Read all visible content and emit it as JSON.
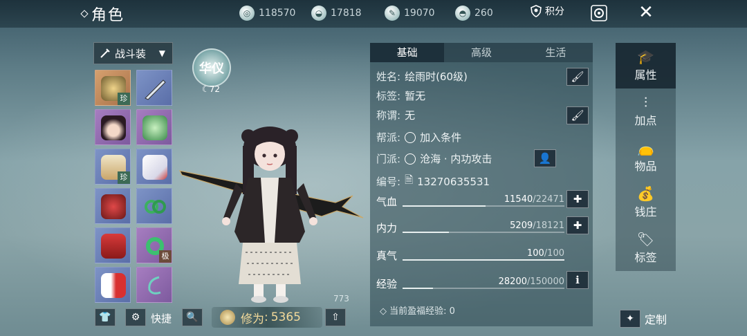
{
  "header": {
    "title": "角色",
    "currencies": [
      {
        "icon": "film-reel-icon",
        "value": "118570"
      },
      {
        "icon": "silver-ingot-icon",
        "value": "17818"
      },
      {
        "icon": "jade-token-icon",
        "value": "19070"
      },
      {
        "icon": "gold-ingot-icon",
        "value": "260"
      }
    ],
    "points_label": "积分"
  },
  "outfit": {
    "selected": "战斗装"
  },
  "equipment": {
    "badges": {
      "rare": "珍",
      "extreme": "极"
    }
  },
  "character": {
    "emblem_text": "华仪",
    "emblem_level": "72",
    "wing_level": "773",
    "cultivation_label": "修为",
    "cultivation_value": "5365"
  },
  "toolbar": {
    "quick_label": "快捷"
  },
  "panel": {
    "tabs": [
      "基础",
      "高级",
      "生活"
    ],
    "name_label": "姓名:",
    "name_value": "绘雨时(60级)",
    "tag_label": "标签:",
    "tag_value": "暂无",
    "title_label": "称谓:",
    "title_value": "无",
    "guild_label": "帮派:",
    "guild_value": "加入条件",
    "sect_label": "门派:",
    "sect_value": "沧海 · 内功攻击",
    "id_label": "编号:",
    "id_value": "13270635531",
    "stats": [
      {
        "label": "气血",
        "current": "11540",
        "max": "/22471",
        "ratio": 0.514
      },
      {
        "label": "内力",
        "current": "5209",
        "max": "/18121",
        "ratio": 0.287
      },
      {
        "label": "真气",
        "current": "100",
        "max": "/100",
        "ratio": 1.0
      },
      {
        "label": "经验",
        "current": "28200",
        "max": "/150000",
        "ratio": 0.188
      }
    ],
    "fortune_label": "当前盈福经验: 0"
  },
  "nav": {
    "items": [
      "属性",
      "加点",
      "物品",
      "钱庄",
      "标签"
    ],
    "custom_label": "定制"
  },
  "colors": {
    "accent_gold": "#f2d99a",
    "panel_bg": "#2e4852"
  }
}
